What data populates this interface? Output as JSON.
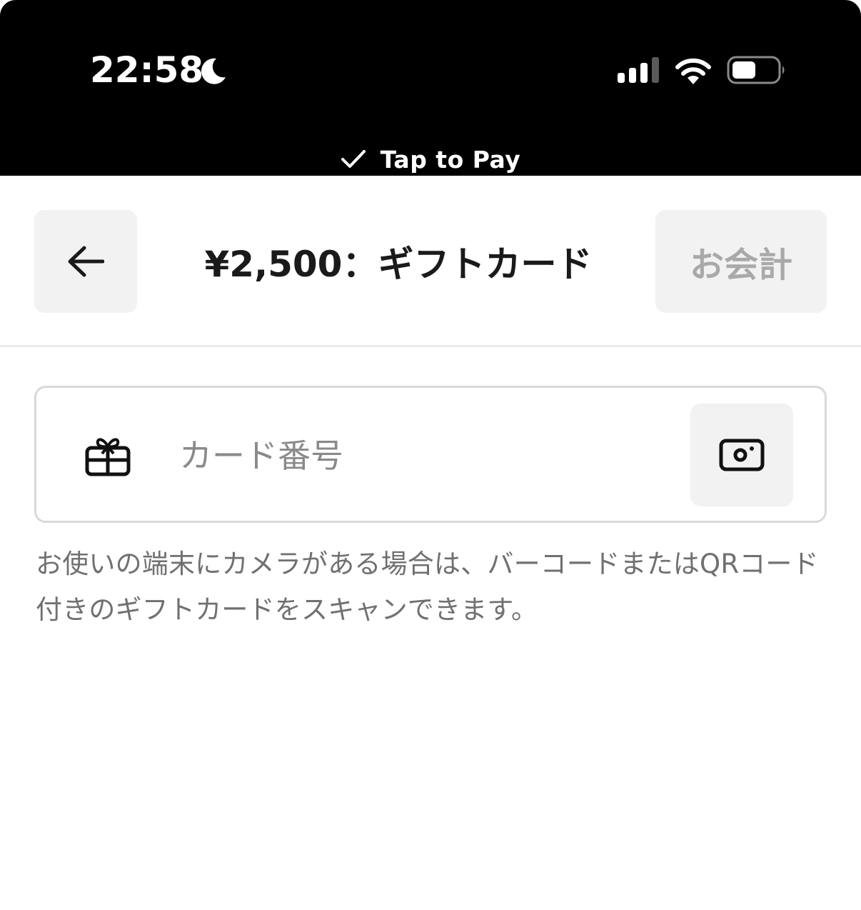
{
  "status_bar": {
    "time": "22:58",
    "icons": [
      "moon-icon",
      "signal-icon",
      "wifi-icon",
      "battery-icon"
    ],
    "banner_icon": "check-icon",
    "banner_label": "Tap to Pay"
  },
  "header": {
    "back_icon": "arrow-left-icon",
    "title": "¥2,500：ギフトカード",
    "checkout_label": "お会計"
  },
  "card_field": {
    "icon": "gift-icon",
    "value": "",
    "placeholder": "カード番号",
    "scan_icon": "camera-icon"
  },
  "helper_text": "お使いの端末にカメラがある場合は、バーコードまたはQRコード付きのギフトカードをスキャンできます。",
  "colors": {
    "status_bar_bg": "#000000",
    "button_bg": "#f2f2f2",
    "disabled_text": "#a9a9a9",
    "helper_text": "#707070",
    "placeholder": "#8a8a8a"
  }
}
